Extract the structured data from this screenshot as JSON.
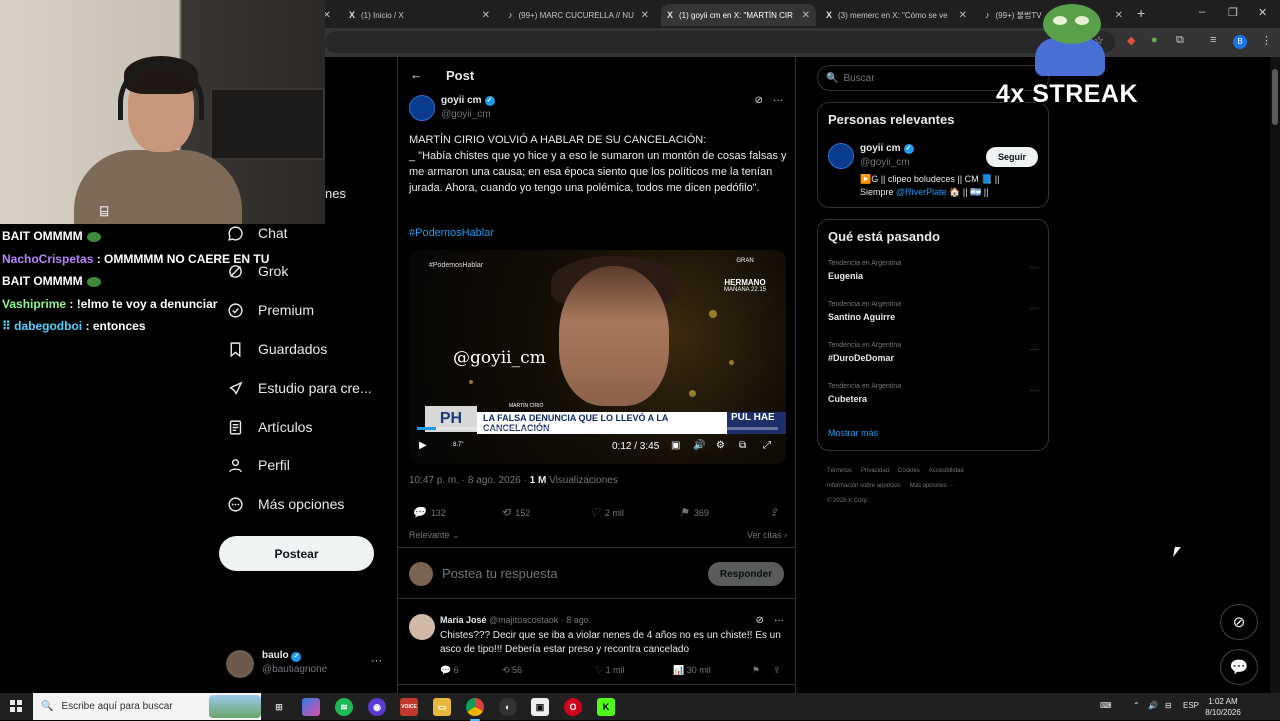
{
  "browser": {
    "tabs": [
      {
        "label": "(1) Inicio / X",
        "favicon": "x-logo"
      },
      {
        "label": "(99+) MARC CUCURELLA // NU",
        "favicon": "tiktok-logo"
      },
      {
        "label": "(1) goyii cm en X: \"MARTÍN CIR",
        "favicon": "x-logo",
        "active": true
      },
      {
        "label": "(3) memerc en X: \"Cómo se ve",
        "favicon": "x-logo"
      },
      {
        "label": "(99+) 불법TV",
        "favicon": "tiktok-logo"
      }
    ],
    "new_tab": "+",
    "window_controls": {
      "minimize": "–",
      "maximize": "❐",
      "close": "✕"
    },
    "profile_initial": "B"
  },
  "stream_overlay": {
    "chat": [
      {
        "user": "",
        "text": "BAIT OMMMM",
        "emote": true
      },
      {
        "user": "NachoCrispetas",
        "text": ": OMMMMM NO CAERE EN TU"
      },
      {
        "user": "",
        "text": "BAIT OMMMM",
        "emote": true
      },
      {
        "user": "Vashiprime",
        "text": ": !elmo te voy a denunciar"
      },
      {
        "user": "dabegodboi",
        "text": ": entonces",
        "badge": "⠿"
      }
    ],
    "streak": "4x STREAK",
    "partial_nav_text": "nes"
  },
  "sidebar": {
    "items": [
      {
        "label": "Chat",
        "icon": "chat-icon"
      },
      {
        "label": "Grok",
        "icon": "grok-icon"
      },
      {
        "label": "Premium",
        "icon": "premium-icon"
      },
      {
        "label": "Guardados",
        "icon": "bookmark-icon"
      },
      {
        "label": "Estudio para cre...",
        "icon": "rocket-icon"
      },
      {
        "label": "Artículos",
        "icon": "article-icon"
      },
      {
        "label": "Perfil",
        "icon": "person-icon"
      },
      {
        "label": "Más opciones",
        "icon": "more-circle-icon"
      }
    ],
    "post_button": "Postear",
    "account": {
      "name": "baulo",
      "handle": "@bautiagnone",
      "more": "···"
    }
  },
  "post": {
    "header_title": "Post",
    "author": {
      "name": "goyii cm",
      "handle": "@goyii_cm"
    },
    "text": "MARTÍN CIRIO VOLVIÓ A HABLAR DE SU CANCELACIÓN:\n_ \"Había chistes que yo hice y a eso le sumaron un montón de cosas falsas y me armaron una causa; en esa época siento que los políticos me la tenían jurada. Ahora, cuando yo tengo una polémica, todos me dicen pedófilo\".",
    "hashtag": "#PodemosHablar",
    "video": {
      "corner_tag": "#PodemosHablar",
      "watermark": "@goyii_cm",
      "channel_top": "GRAN",
      "channel_name": "HERMANO",
      "channel_sub": "MAÑANA 22.15",
      "ph_logo": "PH",
      "lower_name": "MARTÍN CIRIO",
      "lower_third": "LA FALSA DENUNCIA QUE LO LLEVÓ A LA CANCELACIÓN",
      "lower_right": "PUL HAE",
      "time": "0:12 / 3:45",
      "progress": 0.053,
      "small_label": "8.7\""
    },
    "timestamp": "10:47 p. m. · 8 ago. 2026 ·",
    "views_count": "1 M",
    "views_label": "Visualizaciones",
    "stats": {
      "replies": "132",
      "reposts": "152",
      "likes": "2 mil",
      "bookmarks": "369"
    },
    "sort_label": "Relevante",
    "quotes_label": "Ver citas",
    "reply_placeholder": "Postea tu respuesta",
    "reply_button": "Responder"
  },
  "replies": [
    {
      "name": "María José",
      "handle": "@majitoacostaok · 8 ago.",
      "text": "Chistes??? Decir que se iba a violar nenes de 4 años no es un chiste!! Es un asco de tipo!!! Debería estar preso y recontra cancelado",
      "replies": "6",
      "reposts": "56",
      "likes": "1 mil",
      "views": "30 mil"
    }
  ],
  "right": {
    "search_placeholder": "Buscar",
    "relevant_title": "Personas relevantes",
    "relevant_person": {
      "name": "goyii cm",
      "handle": "@goyii_cm",
      "follow": "Seguir",
      "bio_a": "▶️G || clipeo boludeces || CM 📘 ||",
      "bio_b": "Siempre",
      "bio_mention": "@RiverPlate",
      "bio_c": "🏠 || 🇦🇷 ||"
    },
    "trends_title": "Qué está pasando",
    "trends": [
      {
        "context": "Tendencia en Argentina",
        "topic": "Eugenia"
      },
      {
        "context": "Tendencia en Argentina",
        "topic": "Santino Aguirre"
      },
      {
        "context": "Tendencia en Argentina",
        "topic": "#DuroDeDomar"
      },
      {
        "context": "Tendencia en Argentina",
        "topic": "Cubetera"
      }
    ],
    "show_more": "Mostrar más",
    "footer": [
      "Términos",
      "Privacidad",
      "Cookies",
      "Accesibilidad",
      "Información sobre anuncios",
      "Más opciones ···",
      "© 2026 X Corp."
    ]
  },
  "taskbar": {
    "search_placeholder": "Escribe aquí para buscar",
    "language": "ESP",
    "time": "1:02 AM",
    "date": "8/10/2026"
  },
  "colors": {
    "accent": "#1d9bf0",
    "background": "#000000",
    "border": "#2f3336",
    "muted": "#71767b"
  }
}
